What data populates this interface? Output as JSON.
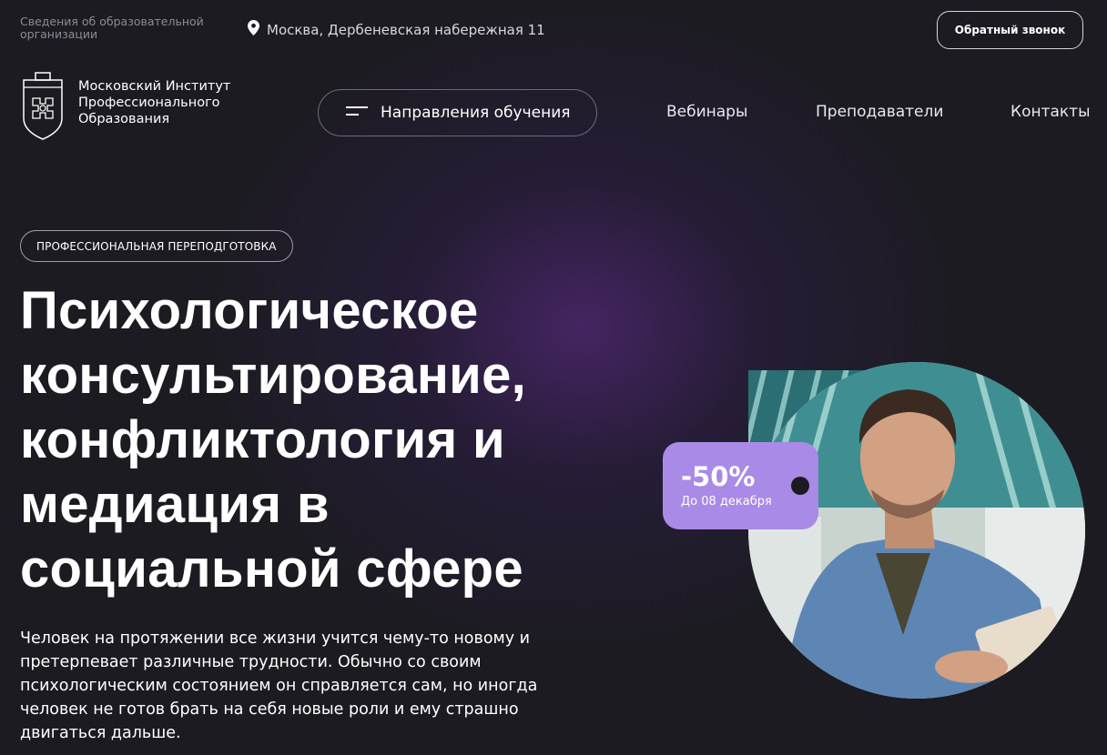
{
  "header": {
    "org_info": "Сведения об образовательной организации",
    "address": "Москва, Дербеневская набережная 11",
    "callback_label": "Обратный звонок"
  },
  "logo": {
    "line1": "Московский Институт",
    "line2": "Профессионального",
    "line3": "Образования"
  },
  "nav": {
    "directions_label": "Направления обучения",
    "links": [
      "Вебинары",
      "Преподаватели",
      "Контакты"
    ]
  },
  "hero": {
    "badge": "ПРОФЕССИОНАЛЬНАЯ ПЕРЕПОДГОТОВКА",
    "title_lines": [
      "Психологическое",
      "консультирование,",
      "конфликтология и",
      "медиация в",
      "социальной сфере"
    ],
    "description": "Человек на протяжении все жизни учится чему-то новому и претерпевает различные трудности. Обычно со своим психологическим состоянием он справляется сам, но иногда человек не готов брать на себя новые роли и ему страшно двигаться дальше."
  },
  "discount": {
    "value": "-50%",
    "until": "До 08 декабря"
  },
  "colors": {
    "background": "#1c1b21",
    "accent": "#a98ae6",
    "glow": "#522878"
  }
}
